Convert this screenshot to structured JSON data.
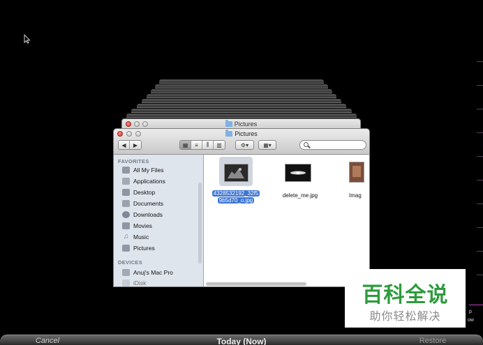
{
  "finder": {
    "back_title": "Pictures",
    "title": "Pictures",
    "sidebar": {
      "favorites_heading": "FAVORITES",
      "favorites": [
        {
          "label": "All My Files",
          "icon": "all-my-files-icon"
        },
        {
          "label": "Applications",
          "icon": "applications-icon"
        },
        {
          "label": "Desktop",
          "icon": "desktop-icon"
        },
        {
          "label": "Documents",
          "icon": "documents-icon"
        },
        {
          "label": "Downloads",
          "icon": "downloads-icon"
        },
        {
          "label": "Movies",
          "icon": "movies-icon"
        },
        {
          "label": "Music",
          "icon": "music-icon"
        },
        {
          "label": "Pictures",
          "icon": "pictures-icon"
        }
      ],
      "devices_heading": "DEVICES",
      "devices": [
        {
          "label": "Anuj's Mac Pro",
          "icon": "mac-pro-icon"
        },
        {
          "label": "iDisk",
          "icon": "idisk-icon"
        }
      ]
    },
    "files": [
      {
        "name": "4328532192_32f59b5d70_o.jpg",
        "line1": "4328532192_32f5",
        "line2": "9b5d70_o.jpg",
        "selected": true
      },
      {
        "name": "delete_me.jpg",
        "selected": false
      },
      {
        "name": "Imag",
        "selected": false
      }
    ]
  },
  "bottom_bar": {
    "cancel": "Cancel",
    "center": "Today (Now)",
    "restore": "Restore"
  },
  "side_labels": {
    "right_top": "p",
    "right_bottom": "ow"
  },
  "watermark": {
    "title": "百科全说",
    "subtitle": "助你轻松解决"
  },
  "colors": {
    "selection": "#3b74d3",
    "watermark_green": "#2e9b3c"
  }
}
